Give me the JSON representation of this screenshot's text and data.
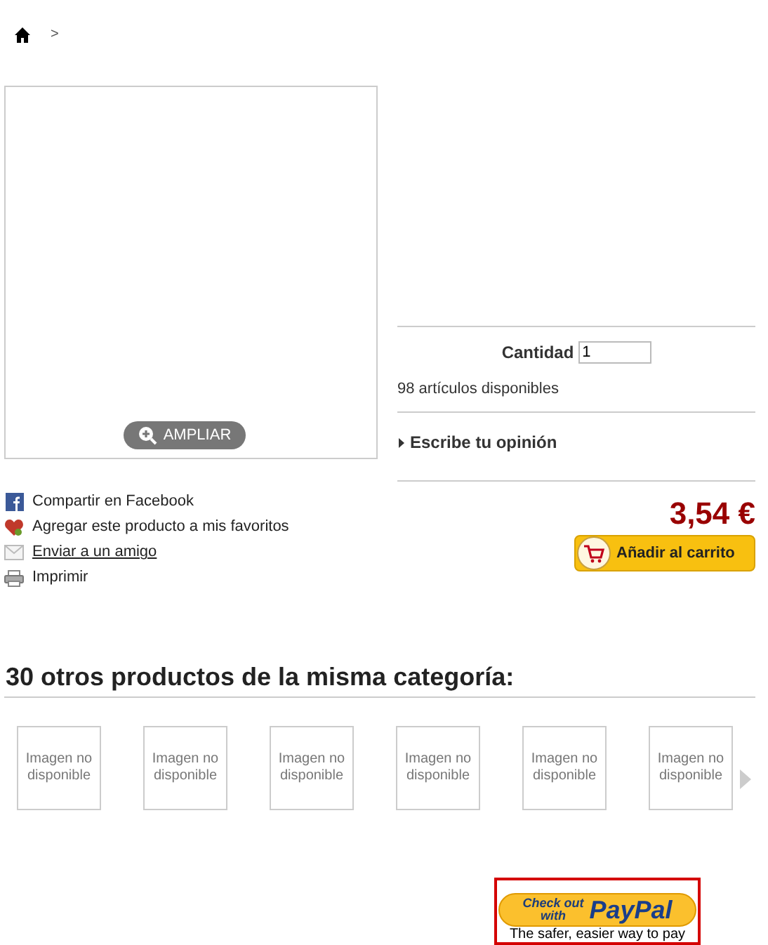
{
  "breadcrumb": {
    "separator": ">"
  },
  "image": {
    "zoom_button": "AMPLIAR"
  },
  "quantity": {
    "label": "Cantidad",
    "value": "1"
  },
  "availability": "98 artículos disponibles",
  "review_link": "Escribe tu opinión",
  "price": "3,54 €",
  "add_to_cart": "Añadir al carrito",
  "actions": [
    {
      "kind": "facebook",
      "label": "Compartir en Facebook",
      "link": false
    },
    {
      "kind": "favorite",
      "label": "Agregar este producto a mis favoritos",
      "link": false
    },
    {
      "kind": "mail",
      "label": "Enviar a un amigo",
      "link": true
    },
    {
      "kind": "print",
      "label": "Imprimir",
      "link": false
    }
  ],
  "related": {
    "title": "30 otros productos de la misma categoría:",
    "items": [
      {
        "label": "Imagen no disponible"
      },
      {
        "label": "Imagen no disponible"
      },
      {
        "label": "Imagen no disponible"
      },
      {
        "label": "Imagen no disponible"
      },
      {
        "label": "Imagen no disponible"
      },
      {
        "label": "Imagen no disponible"
      }
    ]
  },
  "paypal": {
    "line_1": "Check out",
    "line_2": "with",
    "brand": "PayPal",
    "tagline": "The safer, easier way to pay"
  }
}
